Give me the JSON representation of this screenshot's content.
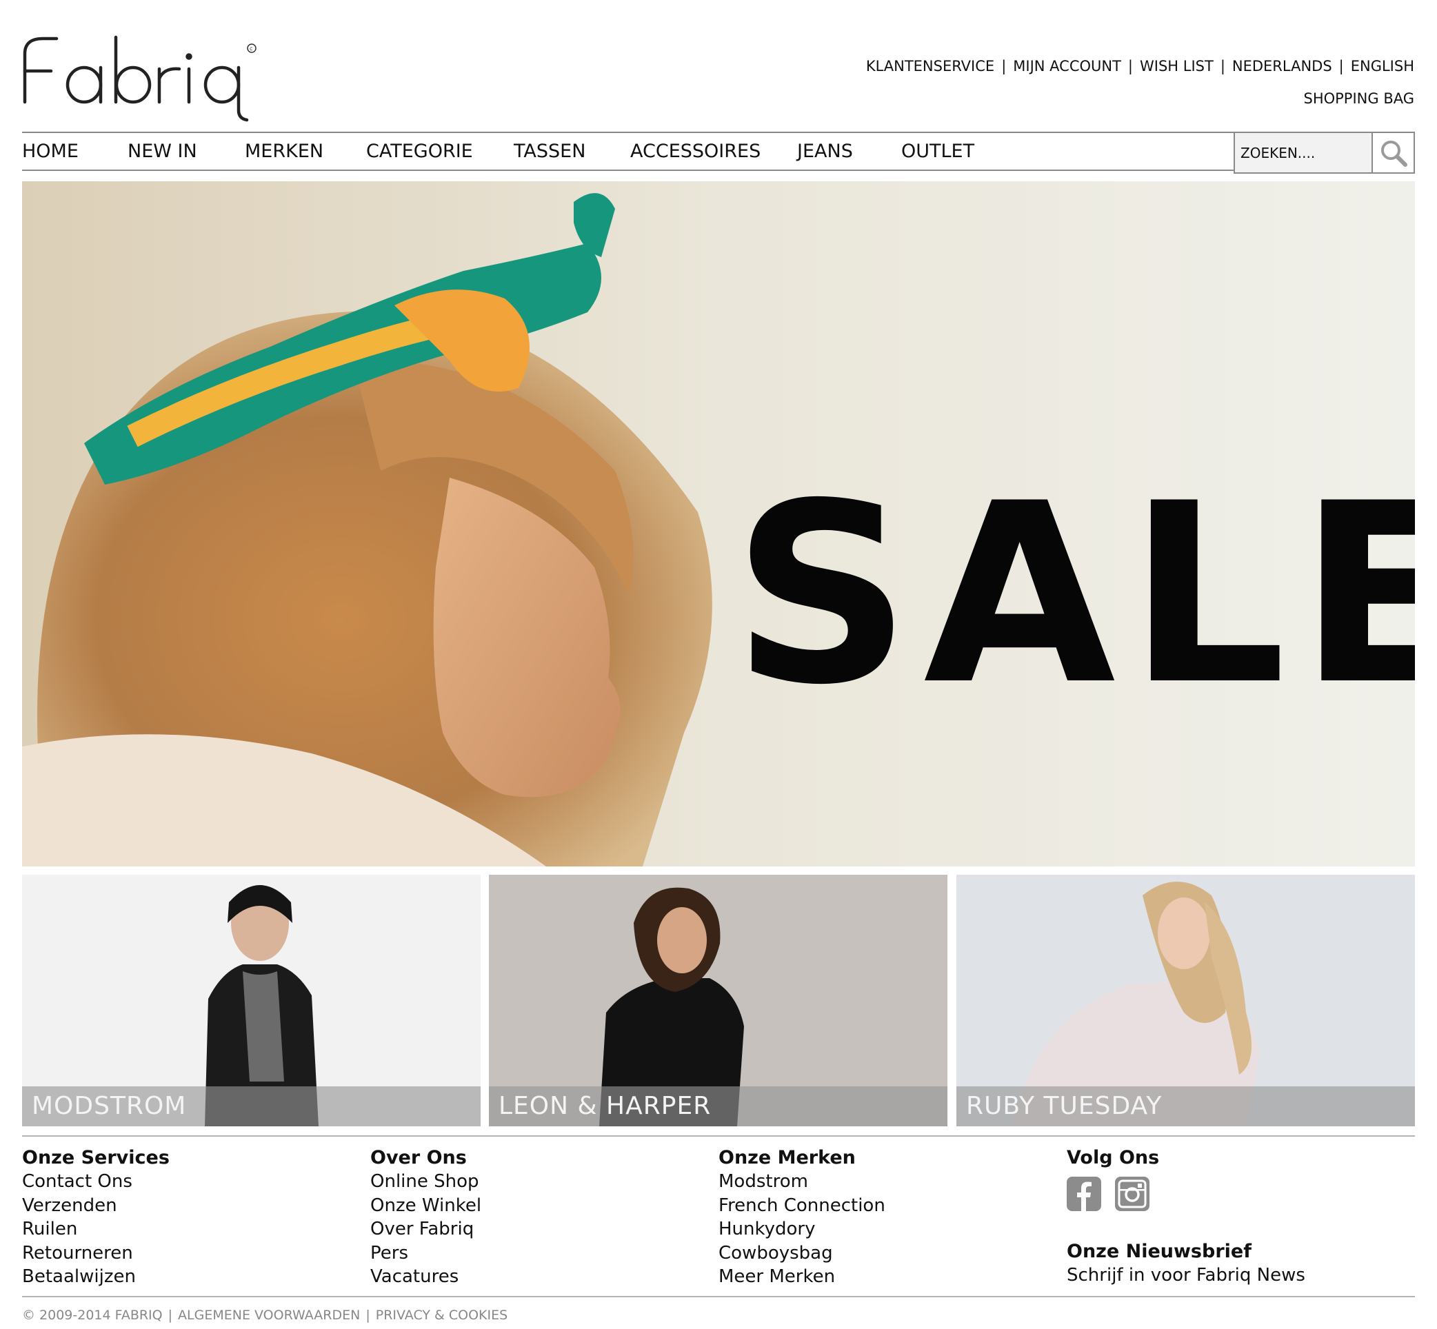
{
  "brand": {
    "logo_text": "Fabriq"
  },
  "top_links": [
    "KLANTENSERVICE",
    "MIJN ACCOUNT",
    "WISH LIST",
    "NEDERLANDS",
    "ENGLISH"
  ],
  "top_separator": "|",
  "shopping_bag": "SHOPPING BAG",
  "nav": {
    "items": [
      "HOME",
      "NEW IN",
      "MERKEN",
      "CATEGORIE",
      "TASSEN",
      "ACCESSOIRES",
      "JEANS",
      "OUTLET"
    ],
    "search_placeholder": "ZOEKEN...."
  },
  "hero": {
    "text": "SALE"
  },
  "tiles": [
    "MODSTROM",
    "LEON & HARPER",
    "RUBY TUESDAY"
  ],
  "footer": {
    "services": {
      "title": "Onze Services",
      "links": [
        "Contact Ons",
        "Verzenden",
        "Ruilen",
        "Retourneren",
        "Betaalwijzen"
      ]
    },
    "about": {
      "title": "Over Ons",
      "links": [
        "Online Shop",
        "Onze Winkel",
        "Over Fabriq",
        "Pers",
        "Vacatures"
      ]
    },
    "brands": {
      "title": "Onze Merken",
      "links": [
        "Modstrom",
        "French Connection",
        "Hunkydory",
        "Cowboysbag",
        "Meer Merken"
      ]
    },
    "follow": {
      "title": "Volg Ons",
      "icons": [
        "facebook-icon",
        "instagram-icon"
      ]
    },
    "newsletter": {
      "title": "Onze Nieuwsbrief",
      "text": "Schrijf in voor Fabriq News"
    }
  },
  "legal": [
    "© 2009-2014 FABRIQ",
    "ALGEMENE VOORWAARDEN",
    "PRIVACY & COOKIES"
  ],
  "colors": {
    "text": "#111111",
    "rule": "#8a8a8a",
    "icon_gray": "#8c8c8c",
    "legal_text": "#888888"
  }
}
